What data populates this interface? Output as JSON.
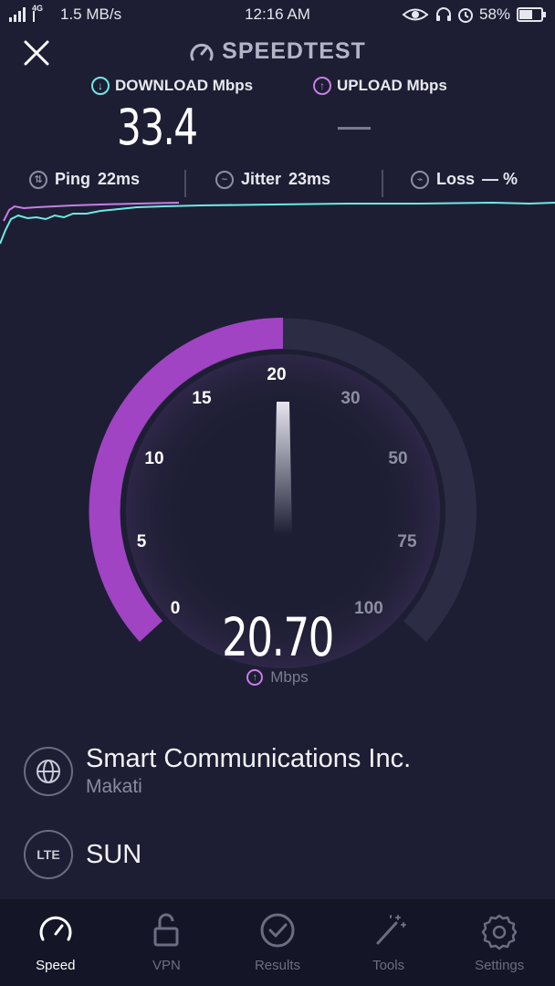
{
  "status_bar": {
    "network_speed": "1.5 MB/s",
    "network_type": "4G",
    "time": "12:16 AM",
    "battery": "58%"
  },
  "header": {
    "title": "SPEEDTEST",
    "download_label": "DOWNLOAD Mbps",
    "upload_label": "UPLOAD Mbps",
    "download_value": "33.4",
    "upload_value": "—"
  },
  "metrics": {
    "ping_label": "Ping",
    "ping_value": "22ms",
    "jitter_label": "Jitter",
    "jitter_value": "23ms",
    "loss_label": "Loss",
    "loss_value": "— %"
  },
  "gauge": {
    "ticks": [
      "0",
      "5",
      "10",
      "15",
      "20",
      "30",
      "50",
      "75",
      "100"
    ],
    "current_value": "20.70",
    "unit": "Mbps",
    "fill_tick": 4,
    "colors": {
      "fill": "#a044c3",
      "track": "#2c2d45",
      "accent_download": "#6fe8e6",
      "accent_upload": "#c77ee6"
    }
  },
  "server": {
    "isp_name": "Smart Communications Inc.",
    "location": "Makati",
    "carrier_badge": "LTE",
    "carrier": "SUN"
  },
  "nav": {
    "items": [
      {
        "label": "Speed",
        "icon": "speedometer-icon"
      },
      {
        "label": "VPN",
        "icon": "lock-icon"
      },
      {
        "label": "Results",
        "icon": "checkmark-icon"
      },
      {
        "label": "Tools",
        "icon": "wand-icon"
      },
      {
        "label": "Settings",
        "icon": "gear-icon"
      }
    ]
  }
}
